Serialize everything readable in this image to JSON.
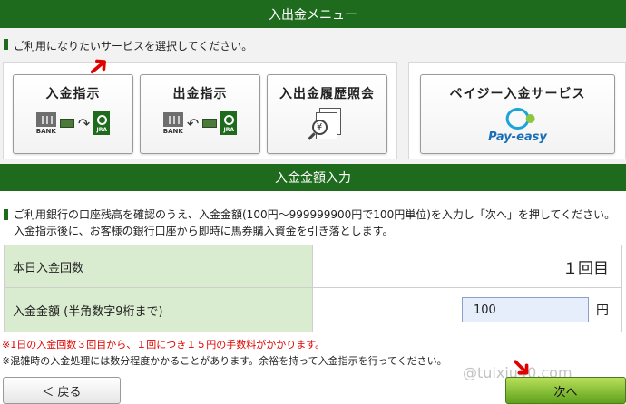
{
  "header": {
    "title": "入出金メニュー"
  },
  "service_prompt": "ご利用になりたいサービスを選択してください。",
  "services": [
    {
      "label": "入金指示",
      "icon": "bank-to-jra-icon"
    },
    {
      "label": "出金指示",
      "icon": "jra-to-bank-icon"
    },
    {
      "label": "入出金履歴照会",
      "icon": "history-search-icon"
    },
    {
      "label": "ペイジー入金サービス",
      "icon": "payeasy-logo"
    }
  ],
  "icon_texts": {
    "bank": "BANK",
    "jra": "JRA",
    "yen": "¥",
    "payeasy": "Pay-easy"
  },
  "deposit_section": {
    "title": "入金金額入力",
    "instruction_1": "ご利用銀行の口座残高を確認のうえ、入金金額(100円～999999900円で100円単位)を入力し「次へ」を押してください。",
    "instruction_2": "入金指示後に、お客様の銀行口座から即時に馬券購入資金を引き落とします。",
    "count_label": "本日入金回数",
    "count_value": "１回目",
    "amount_label": "入金金額 (半角数字9桁まで)",
    "amount_value": "100",
    "amount_unit": "円"
  },
  "notes": {
    "fee": "※1日の入金回数３回目から、１回につき１５円の手数料がかかります。",
    "delay": "※混雑時の入金処理には数分程度かかることがあります。余裕を持って入金指示を行ってください。"
  },
  "buttons": {
    "back": "＜ 戻る",
    "next": "次へ"
  },
  "watermark": "@tuixiu40.com",
  "colors": {
    "header_green": "#1e6b1e",
    "label_green": "#d9ecd0",
    "notice_red": "#e00000",
    "next_green": "#5fa21c"
  }
}
